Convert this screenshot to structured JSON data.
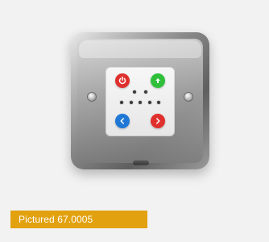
{
  "caption": {
    "text": "Pictured 67.0005",
    "background": "#e2a10f",
    "text_color": "#ffffff"
  },
  "device": {
    "buttons": [
      {
        "icon": "power-icon",
        "color": "#e0302d"
      },
      {
        "icon": "arrow-up-icon",
        "color": "#2fbf3b"
      },
      {
        "icon": "chevron-left-icon",
        "color": "#1f78d6"
      },
      {
        "icon": "chevron-right-icon",
        "color": "#e0302d"
      }
    ]
  }
}
